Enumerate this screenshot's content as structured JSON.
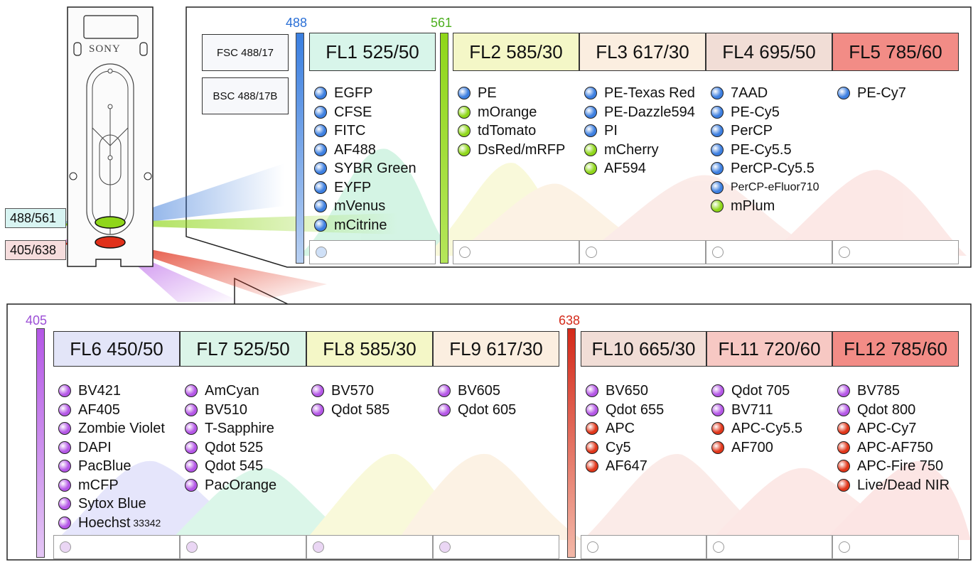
{
  "chip": {
    "brand": "SONY"
  },
  "lasers": {
    "blue": {
      "label": "488",
      "color": "#2a6fd6"
    },
    "green": {
      "label": "561",
      "color": "#4caf1e"
    },
    "violet": {
      "label": "405",
      "color": "#9c4fd6"
    },
    "red": {
      "label": "638",
      "color": "#d42a1a"
    },
    "tag_top": "488/561",
    "tag_bottom": "405/638"
  },
  "scatter": {
    "fsc": "FSC 488/17",
    "bsc": "BSC 488/17B"
  },
  "top_panel": {
    "channels": [
      {
        "header": "FL1 525/50",
        "bg": "#d8f5ea",
        "fluors": [
          {
            "name": "EGFP",
            "dot": "blue"
          },
          {
            "name": "CFSE",
            "dot": "blue"
          },
          {
            "name": "FITC",
            "dot": "blue"
          },
          {
            "name": "AF488",
            "dot": "blue"
          },
          {
            "name": "SYBR Green",
            "dot": "blue"
          },
          {
            "name": "EYFP",
            "dot": "blue"
          },
          {
            "name": "mVenus",
            "dot": "blue"
          },
          {
            "name": "mCitrine",
            "dot": "blue"
          }
        ]
      },
      {
        "header": "FL2 585/30",
        "bg": "#f4f7c7",
        "fluors": [
          {
            "name": "PE",
            "dot": "blue"
          },
          {
            "name": "mOrange",
            "dot": "green"
          },
          {
            "name": "tdTomato",
            "dot": "green"
          },
          {
            "name": "DsRed/mRFP",
            "dot": "green"
          }
        ]
      },
      {
        "header": "FL3 617/30",
        "bg": "#fbeee0",
        "fluors": [
          {
            "name": "PE-Texas Red",
            "dot": "blue"
          },
          {
            "name": "PE-Dazzle594",
            "dot": "blue"
          },
          {
            "name": "PI",
            "dot": "blue"
          },
          {
            "name": "mCherry",
            "dot": "green"
          },
          {
            "name": "AF594",
            "dot": "green"
          }
        ]
      },
      {
        "header": "FL4 695/50",
        "bg": "#f1ddd6",
        "fluors": [
          {
            "name": "7AAD",
            "dot": "blue"
          },
          {
            "name": "PE-Cy5",
            "dot": "blue"
          },
          {
            "name": "PerCP",
            "dot": "blue"
          },
          {
            "name": "PE-Cy5.5",
            "dot": "blue"
          },
          {
            "name": "PerCP-Cy5.5",
            "dot": "blue"
          },
          {
            "name": "PerCP-eFluor710",
            "dot": "blue"
          },
          {
            "name": "mPlum",
            "dot": "green"
          }
        ]
      },
      {
        "header": "FL5 785/60",
        "bg": "#f28c86",
        "fluors": [
          {
            "name": "PE-Cy7",
            "dot": "blue"
          }
        ]
      }
    ]
  },
  "bottom_panel": {
    "channels": [
      {
        "header": "FL6 450/50",
        "bg": "#e3e5f8",
        "fluors": [
          {
            "name": "BV421",
            "dot": "violet"
          },
          {
            "name": "AF405",
            "dot": "violet"
          },
          {
            "name": "Zombie Violet",
            "dot": "violet"
          },
          {
            "name": "DAPI",
            "dot": "violet"
          },
          {
            "name": "PacBlue",
            "dot": "violet"
          },
          {
            "name": "mCFP",
            "dot": "violet"
          },
          {
            "name": "Sytox Blue",
            "dot": "violet"
          },
          {
            "name": "Hoechst",
            "dot": "violet",
            "suffix": "33342"
          }
        ]
      },
      {
        "header": "FL7 525/50",
        "bg": "#dbf4e8",
        "fluors": [
          {
            "name": "AmCyan",
            "dot": "violet"
          },
          {
            "name": "BV510",
            "dot": "violet"
          },
          {
            "name": "T-Sapphire",
            "dot": "violet"
          },
          {
            "name": "Qdot 525",
            "dot": "violet"
          },
          {
            "name": "Qdot 545",
            "dot": "violet"
          },
          {
            "name": "PacOrange",
            "dot": "violet"
          }
        ]
      },
      {
        "header": "FL8 585/30",
        "bg": "#f4f7c7",
        "fluors": [
          {
            "name": "BV570",
            "dot": "violet"
          },
          {
            "name": "Qdot 585",
            "dot": "violet"
          }
        ]
      },
      {
        "header": "FL9 617/30",
        "bg": "#fbeee0",
        "fluors": [
          {
            "name": "BV605",
            "dot": "violet"
          },
          {
            "name": "Qdot 605",
            "dot": "violet"
          }
        ]
      },
      {
        "header": "FL10 665/30",
        "bg": "#f1ddd6",
        "fluors": [
          {
            "name": "BV650",
            "dot": "violet"
          },
          {
            "name": "Qdot 655",
            "dot": "violet"
          },
          {
            "name": "APC",
            "dot": "red"
          },
          {
            "name": "Cy5",
            "dot": "red"
          },
          {
            "name": "AF647",
            "dot": "red"
          }
        ]
      },
      {
        "header": "FL11 720/60",
        "bg": "#f7c8c3",
        "fluors": [
          {
            "name": "Qdot 705",
            "dot": "violet"
          },
          {
            "name": "BV711",
            "dot": "violet"
          },
          {
            "name": "APC-Cy5.5",
            "dot": "red"
          },
          {
            "name": "AF700",
            "dot": "red"
          }
        ]
      },
      {
        "header": "FL12 785/60",
        "bg": "#f28c86",
        "fluors": [
          {
            "name": "BV785",
            "dot": "violet"
          },
          {
            "name": "Qdot 800",
            "dot": "violet"
          },
          {
            "name": "APC-Cy7",
            "dot": "red"
          },
          {
            "name": "APC-AF750",
            "dot": "red"
          },
          {
            "name": "APC-Fire 750",
            "dot": "red"
          },
          {
            "name": "Live/Dead NIR",
            "dot": "red"
          }
        ]
      }
    ]
  },
  "dot_colors": {
    "blue": "#3d7fe0",
    "green": "#8fd61a",
    "violet": "#b457e6",
    "red": "#e0361a"
  }
}
